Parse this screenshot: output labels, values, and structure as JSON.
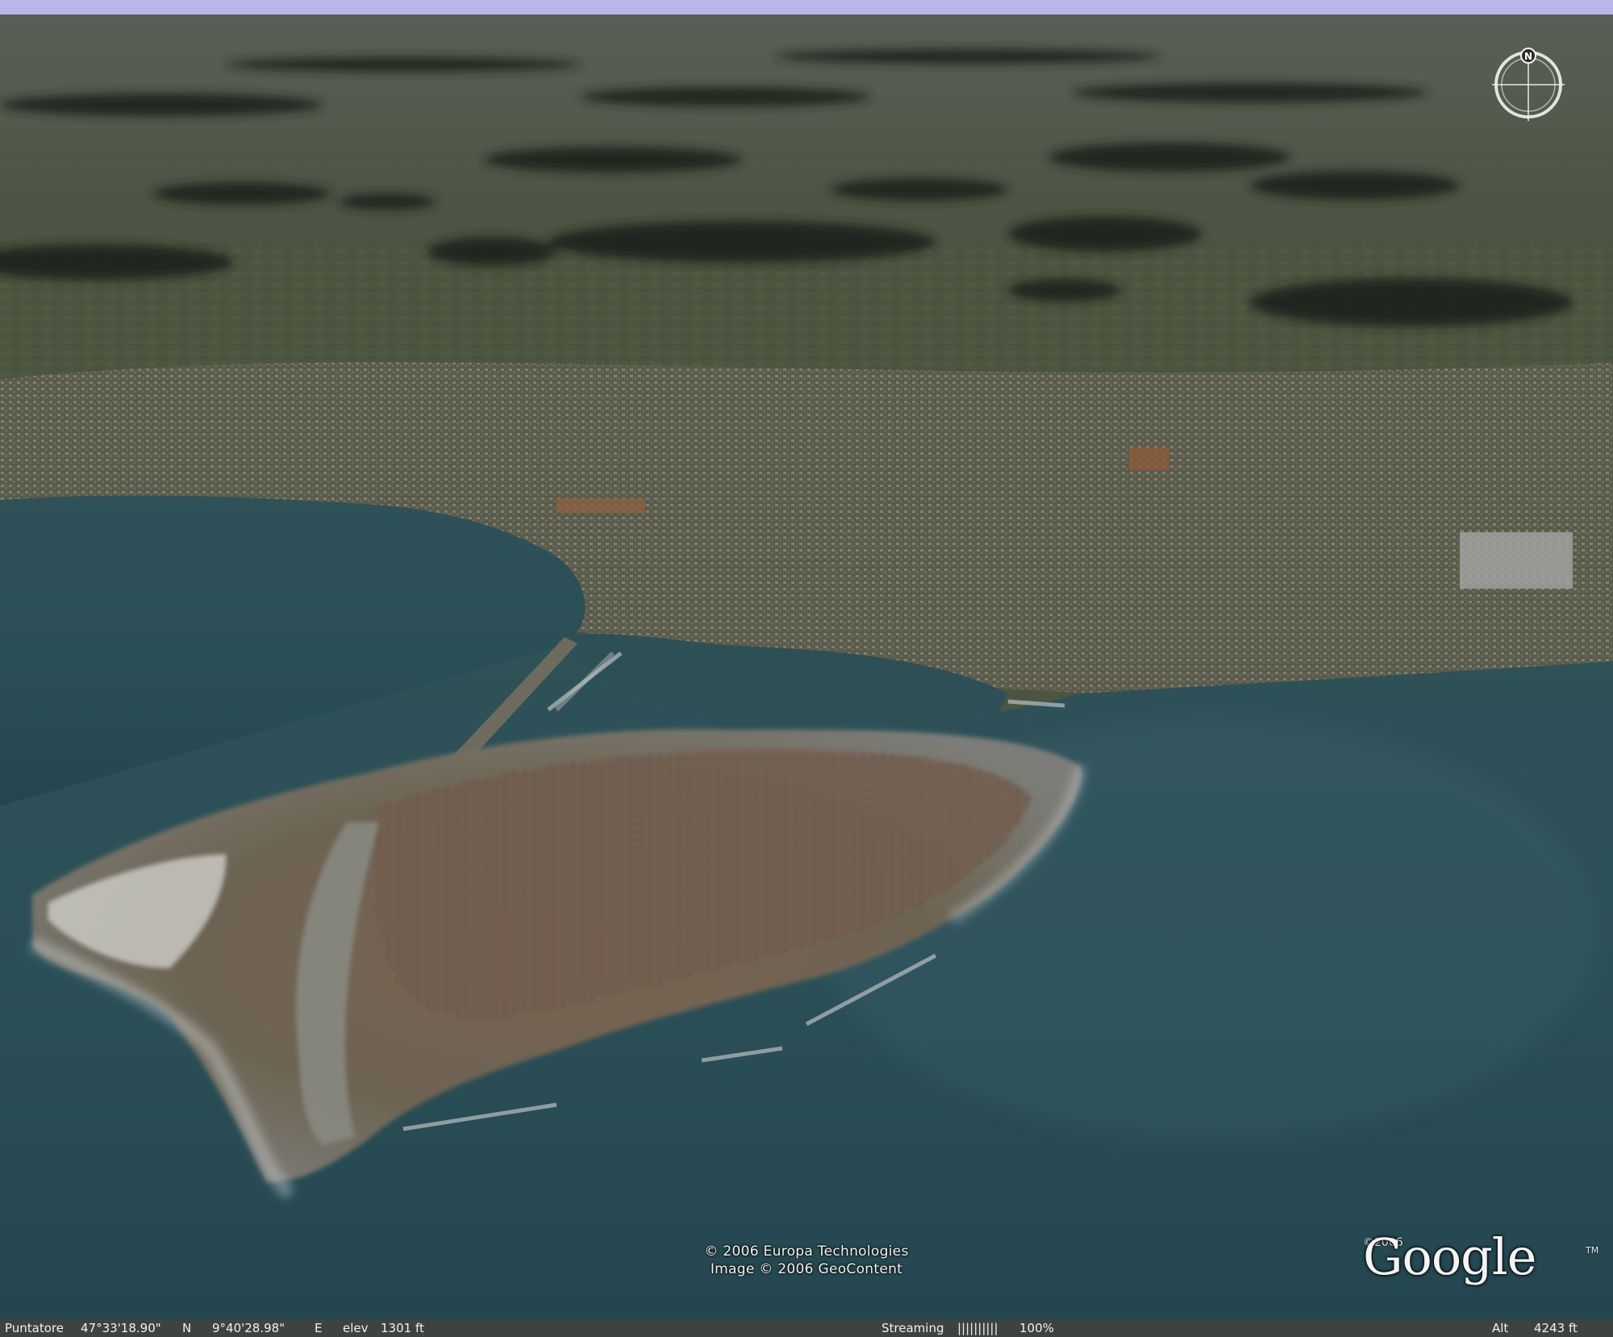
{
  "copyright": {
    "line1": "© 2006 Europa Technologies",
    "line2": "Image © 2006 GeoContent"
  },
  "logo": {
    "year": "©2006",
    "text": "Google",
    "tm": "TM"
  },
  "compass": {
    "north_label": "N",
    "icon": "compass-icon"
  },
  "status": {
    "pointer_label": "Puntatore",
    "lat": "47°33'18.90\"",
    "lat_dir": "N",
    "lon": "9°40'28.98\"",
    "lon_dir": "E",
    "elev_label": "elev",
    "elev_value": "1301 ft",
    "streaming_label": "Streaming",
    "streaming_bar": "||||||||||",
    "streaming_percent": "100%",
    "streaming_progress": 1.0,
    "alt_label": "Alt",
    "alt_value": "4243 ft"
  },
  "colors": {
    "water": "#2c4e55",
    "water_light": "#4a7078",
    "land_distant": "#4b5240",
    "forest": "#1f241f",
    "town": "#6e6a58",
    "old_town_roofs": "#8a5a42",
    "sky": "#b9b6e8",
    "text": "#f0f0f0"
  }
}
